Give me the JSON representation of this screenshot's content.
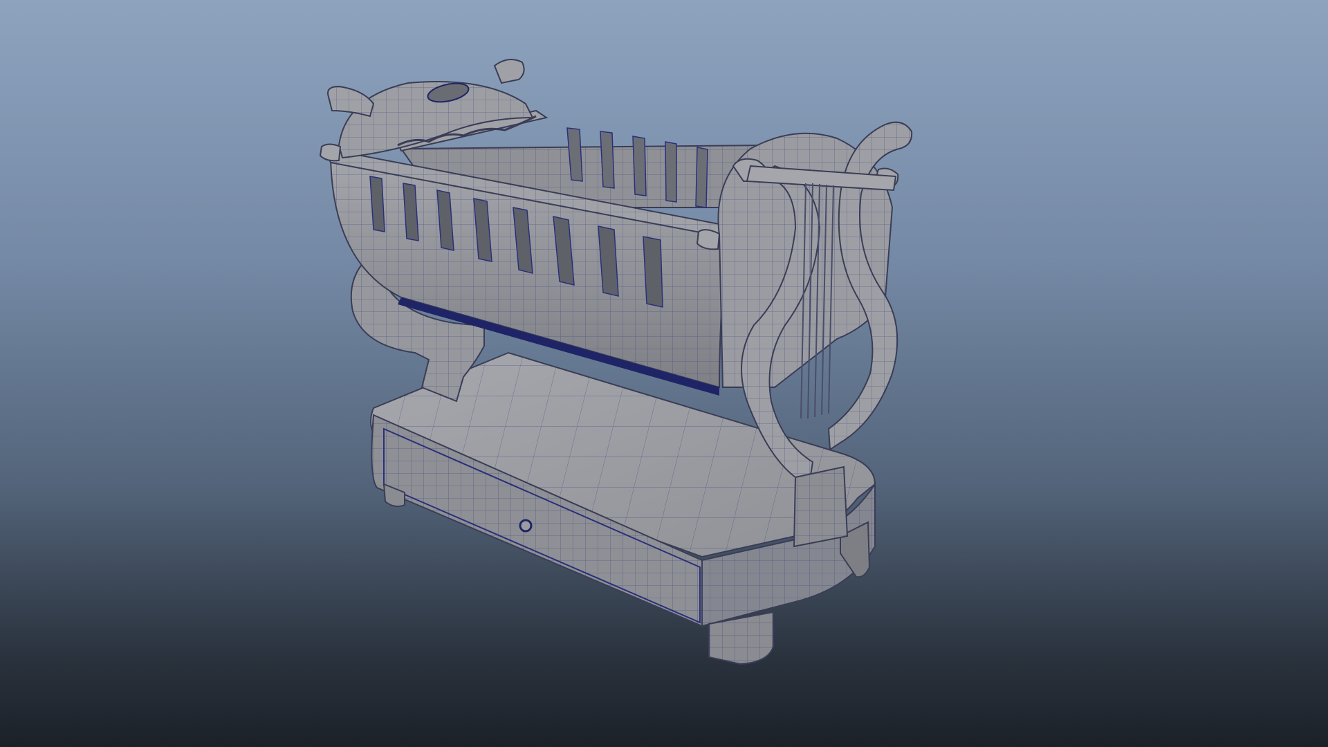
{
  "viewport": {
    "background_top": "#8ea3be",
    "background_bottom": "#1c2128",
    "model_surface_color": "#9a9ca1",
    "model_shadow_color": "#6d6f75",
    "wireframe_color": "#2a2f7a"
  }
}
